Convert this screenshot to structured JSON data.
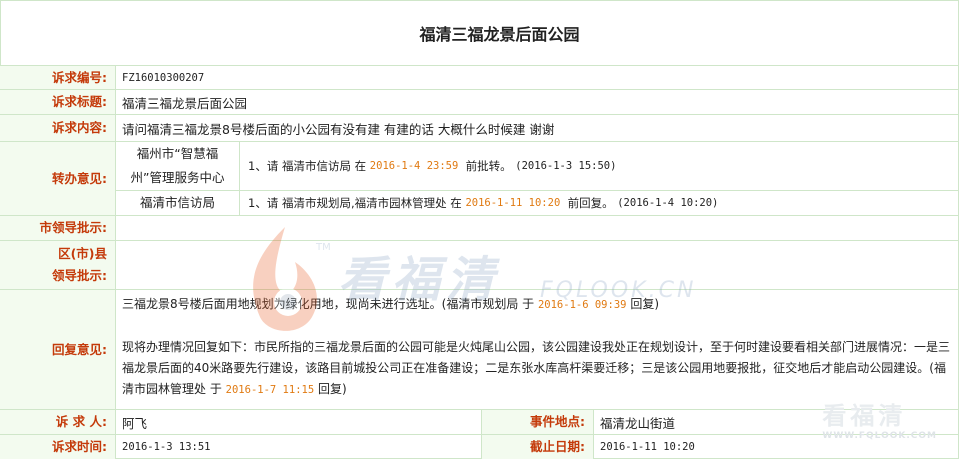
{
  "page_title": "福清三福龙景后面公园",
  "labels": {
    "number": "诉求编号:",
    "title": "诉求标题:",
    "content": "诉求内容:",
    "transfer": "转办意见:",
    "city_leader": "市领导批示:",
    "district_leader_1": "区(市)县",
    "district_leader_2": "领导批示:",
    "reply": "回复意见:",
    "person": "诉 求 人:",
    "event_location": "事件地点:",
    "time": "诉求时间:",
    "deadline": "截止日期:"
  },
  "values": {
    "number": "FZ16010300207",
    "title": "福清三福龙景后面公园",
    "content": "请问福清三福龙景8号楼后面的小公园有没有建 有建的话 大概什么时候建 谢谢",
    "person": "阿飞",
    "event_location": "福清龙山街道",
    "time": "2016-1-3 13:51",
    "deadline": "2016-1-11 10:20"
  },
  "transfers": [
    {
      "dept": "福州市“智慧福州”管理服务中心",
      "text_prefix": "1、请 福清市信访局 在",
      "deadline": "2016-1-4 23:59",
      "text_suffix": "前批转。",
      "stamp": "(2016-1-3 15:50)"
    },
    {
      "dept": "福清市信访局",
      "text_prefix": "1、请 福清市规划局,福清市园林管理处 在",
      "deadline": "2016-1-11 10:20",
      "text_suffix": "前回复。",
      "stamp": "(2016-1-4 10:20)"
    }
  ],
  "reply": {
    "part1_prefix": "三福龙景8号楼后面用地规划为绿化用地，现尚未进行选址。(福清市规划局 于",
    "part1_time": "2016-1-6 09:39",
    "part1_suffix": "回复)",
    "part2_prefix": "现将办理情况回复如下：市民所指的三福龙景后面的公园可能是火炖尾山公园，该公园建设我处正在规划设计，至于何时建设要看相关部门进展情况：一是三福龙景后面的40米路要先行建设，该路目前城投公司正在准备建设；二是东张水库高杆渠要迁移；三是该公园用地要报批，征交地后才能启动公园建设。(福清市园林管理处 于",
    "part2_time": "2016-1-7 11:15",
    "part2_suffix": "回复)"
  },
  "watermark": {
    "brand": "看福清",
    "domain": "FQLOOK.CN",
    "tm": "TM",
    "corner_brand": "看福清",
    "corner_domain": "WWW.FQLOOK.COM"
  },
  "colors": {
    "label_text": "#c43a0a",
    "label_bg": "#f3fbef",
    "border": "#cfe6c9",
    "time_highlight": "#e07a12"
  }
}
